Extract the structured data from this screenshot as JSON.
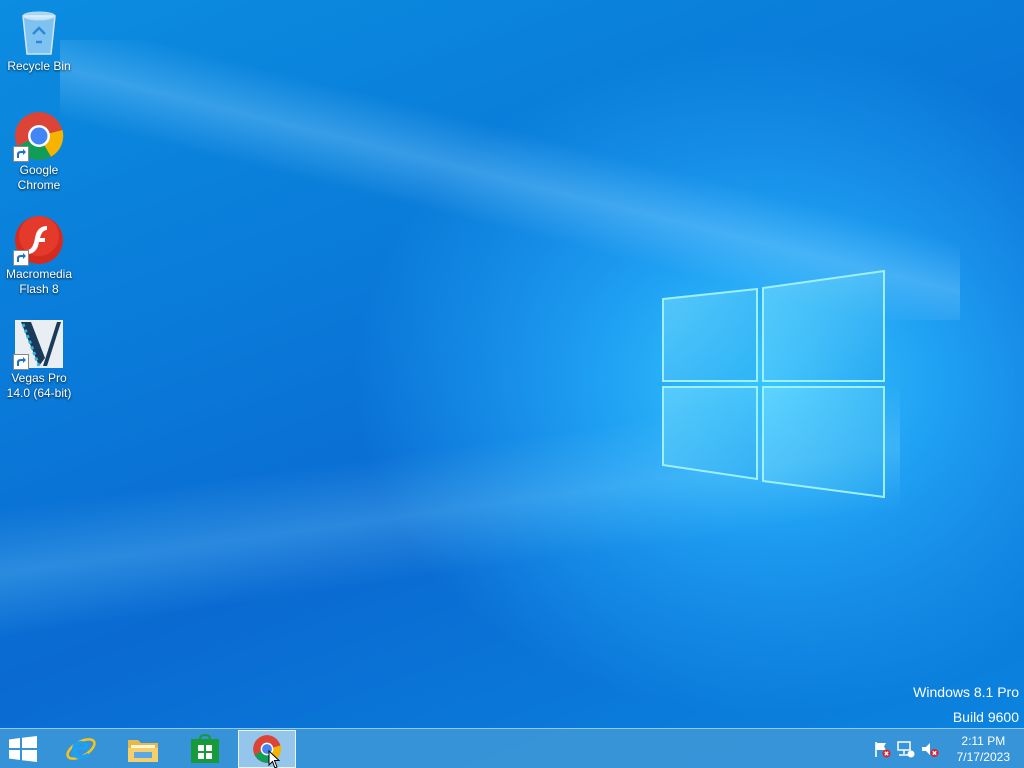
{
  "desktop": {
    "icons": [
      {
        "label": "Recycle Bin",
        "icon": "recycle-bin-icon"
      },
      {
        "label": "Google Chrome",
        "icon": "chrome-icon"
      },
      {
        "label": "Macromedia Flash 8",
        "icon": "flash-icon"
      },
      {
        "label": "Vegas Pro 14.0 (64-bit)",
        "icon": "vegas-pro-icon"
      }
    ],
    "watermark": {
      "line1": "Windows 8.1 Pro",
      "line2": "Build 9600"
    }
  },
  "taskbar": {
    "pinned": [
      {
        "name": "start",
        "icon": "windows-logo-icon"
      },
      {
        "name": "internet-explorer",
        "icon": "ie-icon"
      },
      {
        "name": "file-explorer",
        "icon": "folder-icon"
      },
      {
        "name": "store",
        "icon": "store-icon"
      },
      {
        "name": "google-chrome",
        "icon": "chrome-icon",
        "active": true
      }
    ],
    "tray": {
      "icons": [
        "action-center-flag-icon",
        "network-icon",
        "volume-muted-icon"
      ],
      "time": "2:11 PM",
      "date": "7/17/2023"
    }
  },
  "colors": {
    "desktop_blue": "#0a7ad8",
    "taskbar": "#3c96d7"
  }
}
